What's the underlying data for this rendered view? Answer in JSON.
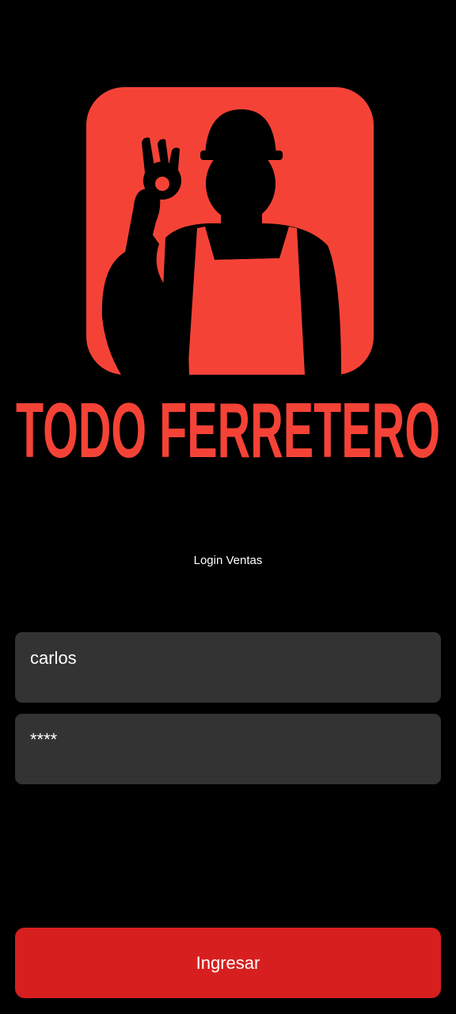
{
  "brand": {
    "name": "TODO FERRETERO",
    "logo_icon": "worker-ok-gesture-icon",
    "accent_color": "#f44336",
    "background_color": "#000000"
  },
  "login": {
    "subtitle": "Login Ventas",
    "username_value": "carlos",
    "password_display": "****",
    "field_color": "#333333"
  },
  "actions": {
    "submit_label": "Ingresar",
    "submit_color": "#d81f1f"
  }
}
